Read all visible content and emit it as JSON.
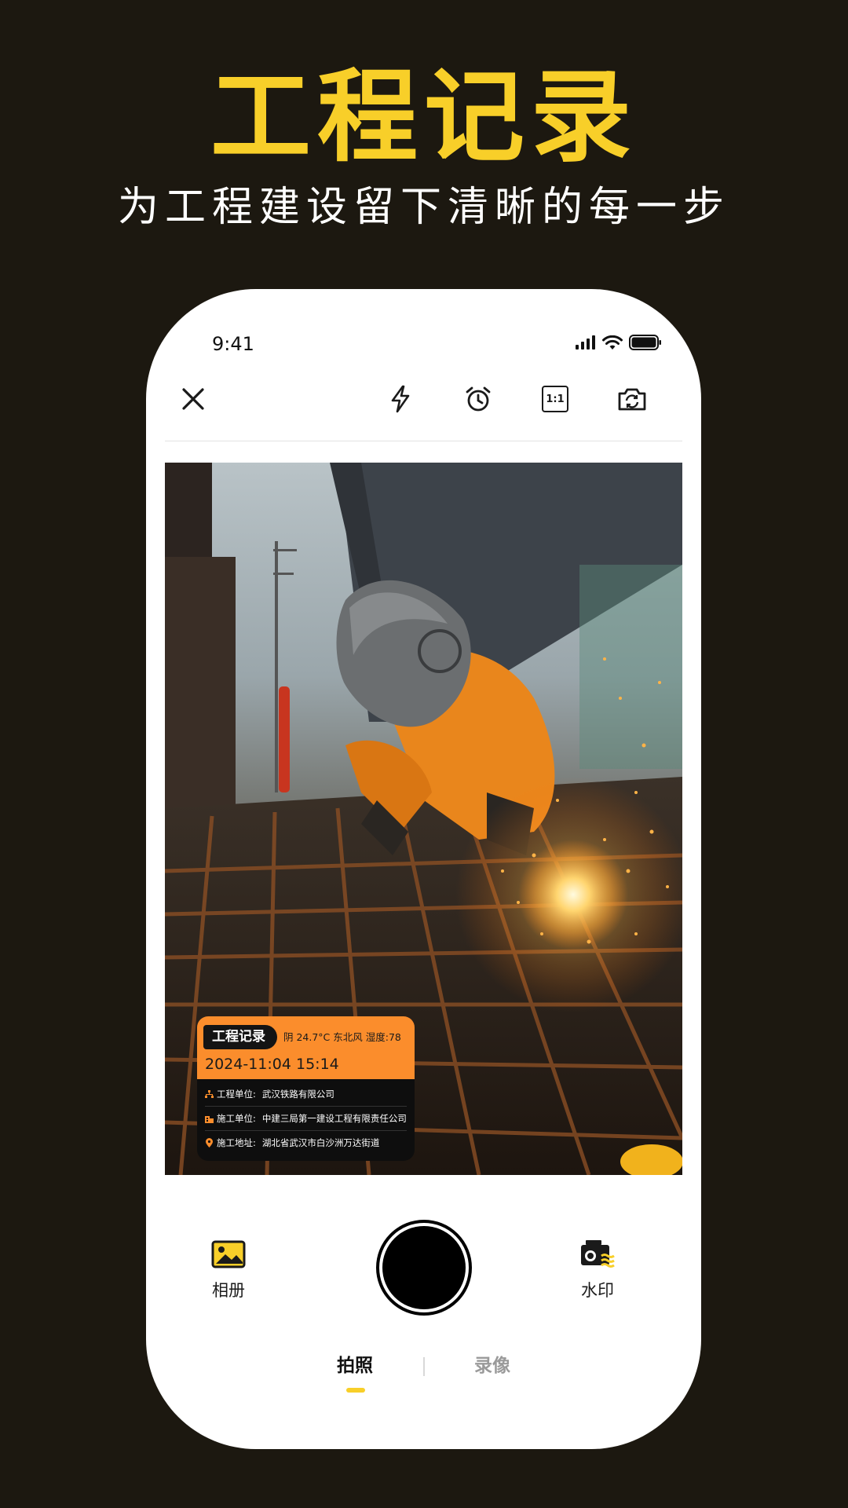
{
  "promo": {
    "headline": "工程记录",
    "subheadline": "为工程建设留下清晰的每一步"
  },
  "status_bar": {
    "time": "9:41"
  },
  "toolbar": {
    "close_icon": "close-icon",
    "flash_icon": "flash-icon",
    "timer_icon": "timer-icon",
    "ratio_label": "1:1",
    "switch_camera_icon": "camera-switch-icon"
  },
  "watermark": {
    "tag": "工程记录",
    "weather": "阴 24.7°C 东北风 湿度:78",
    "datetime": "2024-11:04 15:14",
    "rows": [
      {
        "icon": "org-icon",
        "label": "工程单位:",
        "value": "武汉铁路有限公司"
      },
      {
        "icon": "building-icon",
        "label": "施工单位:",
        "value": "中建三局第一建设工程有限责任公司"
      },
      {
        "icon": "location-pin-icon",
        "label": "施工地址:",
        "value": "湖北省武汉市白沙洲万达街道"
      }
    ]
  },
  "controls": {
    "album_label": "相册",
    "watermark_label": "水印"
  },
  "modes": {
    "photo": "拍照",
    "video": "录像",
    "active": "photo"
  },
  "colors": {
    "background": "#1c1810",
    "accent_yellow": "#f8cf29",
    "watermark_orange": "#fb8d2c"
  }
}
